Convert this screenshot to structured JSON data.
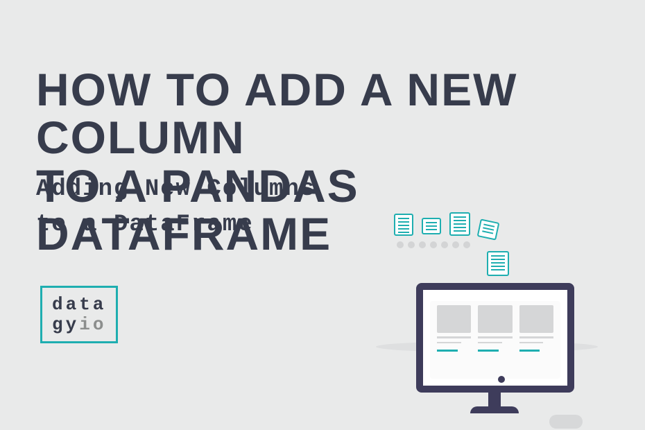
{
  "title": {
    "line1": "HOW TO ADD A NEW COLUMN",
    "line2": "TO A PANDAS DATAFRAME"
  },
  "subtitle": {
    "line1": "Adding New Columns",
    "line2": "to a DataFrame"
  },
  "logo": {
    "line1": "data",
    "line2a": "gy",
    "line2b": "io"
  }
}
